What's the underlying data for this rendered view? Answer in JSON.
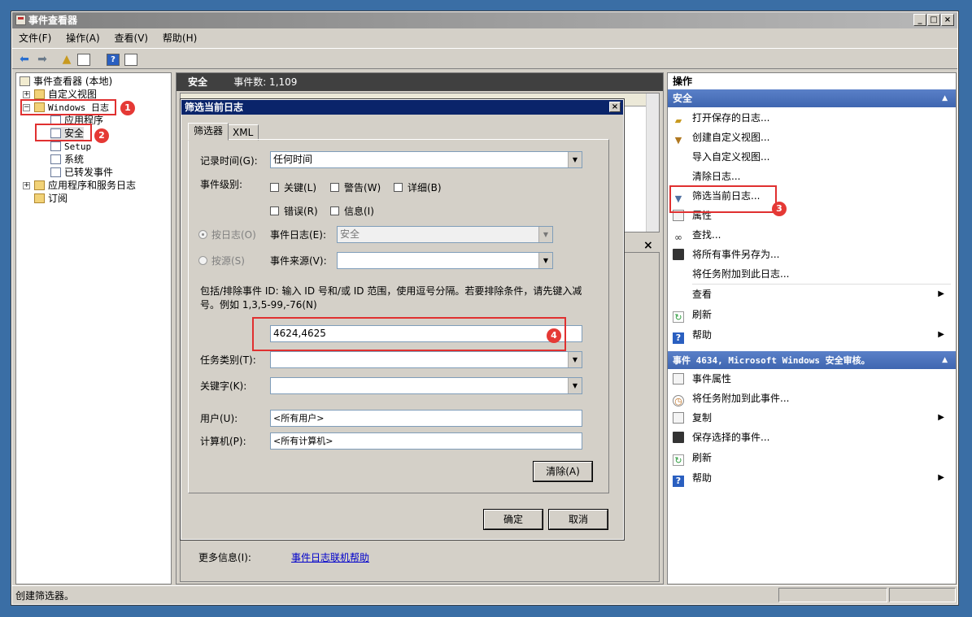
{
  "window": {
    "title": "事件查看器",
    "min": "_",
    "max": "□",
    "close": "×"
  },
  "menu": [
    "文件(F)",
    "操作(A)",
    "查看(V)",
    "帮助(H)"
  ],
  "tree": {
    "root": "事件查看器 (本地)",
    "custom_views": "自定义视图",
    "windows_logs": "Windows 日志",
    "application": "应用程序",
    "security": "安全",
    "setup": "Setup",
    "system": "系统",
    "forwarded": "已转发事件",
    "app_services": "应用程序和服务日志",
    "subscriptions": "订阅"
  },
  "center": {
    "title": "安全",
    "count_label": "事件数: 1,109",
    "more_info_label": "更多信息(I):",
    "more_info_link": "事件日志联机帮助",
    "close_x": "×"
  },
  "dialog": {
    "title": "筛选当前日志",
    "close": "×",
    "tab_filter": "筛选器",
    "tab_xml": "XML",
    "logged_label": "记录时间(G):",
    "logged_value": "任何时间",
    "level_label": "事件级别:",
    "level_critical": "关键(L)",
    "level_warning": "警告(W)",
    "level_verbose": "详细(B)",
    "level_error": "错误(R)",
    "level_info": "信息(I)",
    "by_log": "按日志(O)",
    "event_logs_label": "事件日志(E):",
    "event_logs_value": "安全",
    "by_source": "按源(S)",
    "event_sources_label": "事件来源(V):",
    "event_sources_value": "",
    "ids_help": "包括/排除事件 ID: 输入 ID 号和/或 ID 范围，使用逗号分隔。若要排除条件，请先键入减号。例如 1,3,5-99,-76(N)",
    "ids_value": "4624,4625",
    "task_label": "任务类别(T):",
    "task_value": "",
    "keywords_label": "关键字(K):",
    "keywords_value": "",
    "user_label": "用户(U):",
    "user_value": "<所有用户>",
    "computer_label": "计算机(P):",
    "computer_value": "<所有计算机>",
    "clear": "清除(A)",
    "ok": "确定",
    "cancel": "取消"
  },
  "actions": {
    "header": "操作",
    "section1": "安全",
    "items1": [
      "打开保存的日志...",
      "创建自定义视图...",
      "导入自定义视图...",
      "清除日志...",
      "筛选当前日志...",
      "属性",
      "查找...",
      "将所有事件另存为...",
      "将任务附加到此日志...",
      "查看",
      "刷新",
      "帮助"
    ],
    "section2": "事件 4634, Microsoft Windows 安全审核。",
    "items2": [
      "事件属性",
      "将任务附加到此事件...",
      "复制",
      "保存选择的事件...",
      "刷新",
      "帮助"
    ]
  },
  "badges": [
    "1",
    "2",
    "3",
    "4"
  ],
  "status": {
    "text": "创建筛选器。"
  },
  "colors": {
    "annotation": "#e03030",
    "section": "#3f66b0",
    "dialog_title": "#0a246a"
  }
}
